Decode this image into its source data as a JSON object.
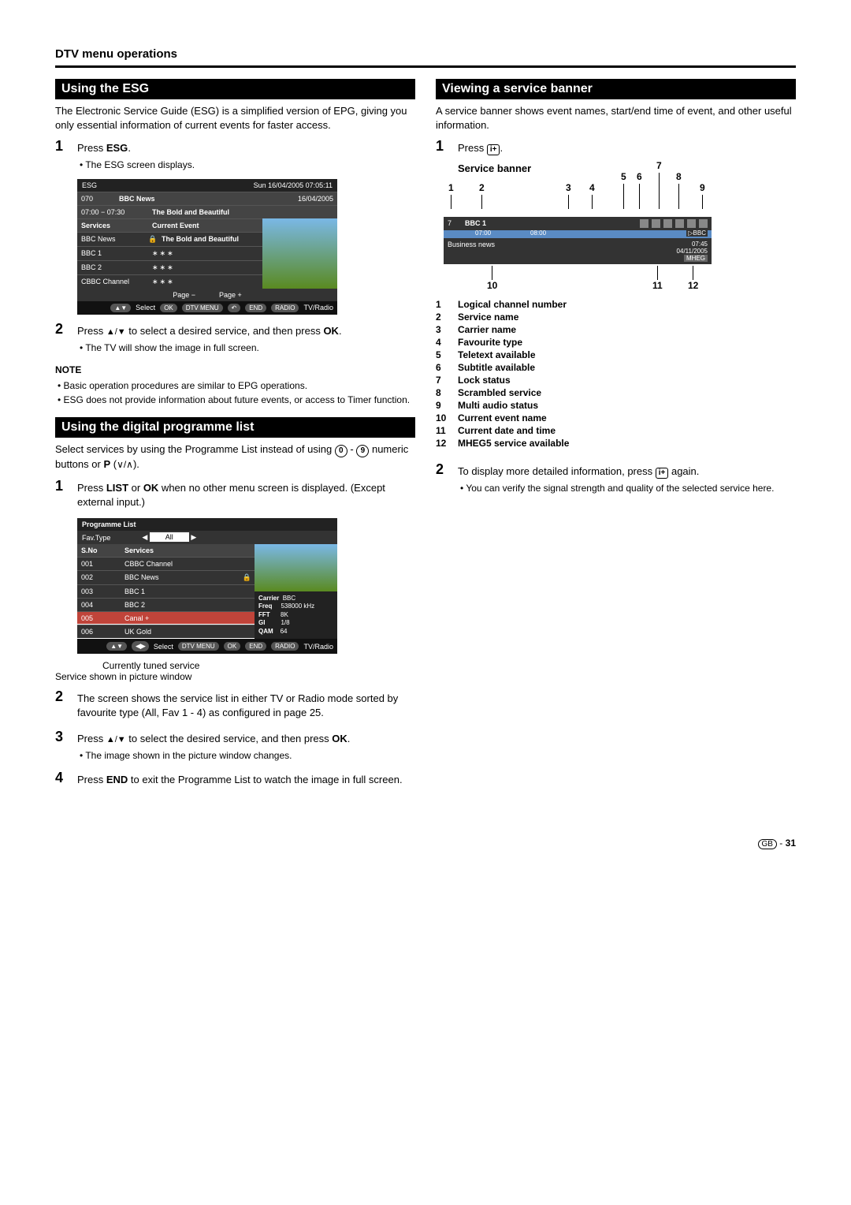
{
  "page_heading": "DTV menu operations",
  "left": {
    "sec1_title": "Using the ESG",
    "sec1_intro": "The Electronic Service Guide (ESG) is a simplified version of EPG, giving you only essential information of current events for faster access.",
    "s1_step1_a": "Press ",
    "s1_step1_b": "ESG",
    "s1_step1_c": ".",
    "s1_step1_bullet": "• The ESG screen displays.",
    "esg": {
      "title": "ESG",
      "datetime": "Sun  16/04/2005  07:05:11",
      "ch_num": "070",
      "ch_name": "BBC News",
      "ch_date": "16/04/2005",
      "time_range": "07:00 − 07:30",
      "cur_prog": "The Bold and Beautiful",
      "col_services": "Services",
      "col_event": "Current Event",
      "rows": [
        {
          "svc": "BBC News",
          "ev": "The Bold and Beautiful",
          "locked": true
        },
        {
          "svc": "BBC 1",
          "ev": "∗∗∗"
        },
        {
          "svc": "BBC 2",
          "ev": "∗∗∗"
        },
        {
          "svc": "CBBC Channel",
          "ev": "∗∗∗"
        }
      ],
      "page_minus": "Page −",
      "page_plus": "Page +",
      "foot_select": "Select",
      "foot_ok": "OK",
      "foot_dtv": "DTV MENU",
      "foot_end": "END",
      "foot_radio": "RADIO",
      "foot_tvr": "TV/Radio"
    },
    "s1_step2_a": "Press ",
    "s1_step2_b": " to select a desired service, and then press ",
    "s1_step2_c": "OK",
    "s1_step2_d": ".",
    "s1_step2_bullet": "• The TV will show the image in full screen.",
    "note_label": "NOTE",
    "note1": "• Basic operation procedures are similar to EPG operations.",
    "note2": "• ESG does not provide information about future events, or access to Timer function.",
    "sec2_title": "Using the digital programme list",
    "sec2_intro_a": "Select services by using the Programme List instead of using ",
    "sec2_intro_b": " - ",
    "sec2_intro_c": " numeric buttons or ",
    "sec2_intro_d": "P",
    "sec2_intro_e": " (",
    "sec2_intro_f": ").",
    "s2_step1_a": "Press ",
    "s2_step1_b": "LIST",
    "s2_step1_c": " or ",
    "s2_step1_d": "OK",
    "s2_step1_e": " when no other menu screen is displayed. (Except external input.)",
    "plist": {
      "title": "Programme List",
      "fav_label": "Fav.Type",
      "fav_val": "All",
      "col_sno": "S.No",
      "col_svc": "Services",
      "rows": [
        {
          "n": "001",
          "s": "CBBC Channel"
        },
        {
          "n": "002",
          "s": "BBC News",
          "locked": true
        },
        {
          "n": "003",
          "s": "BBC 1"
        },
        {
          "n": "004",
          "s": "BBC 2"
        },
        {
          "n": "005",
          "s": "Canal +",
          "hl": true
        },
        {
          "n": "006",
          "s": "UK Gold",
          "sel": true
        }
      ],
      "info": {
        "Carrier": "BBC",
        "Freq": "538000 kHz",
        "FFT": "8K",
        "GI": "1/8",
        "QAM": "64"
      },
      "foot_select": "Select",
      "foot_ok": "OK",
      "foot_dtv": "DTV MENU",
      "foot_end": "END",
      "foot_radio": "RADIO",
      "foot_tvr": "TV/Radio"
    },
    "cap_tuned": "Currently tuned service",
    "cap_shown": "Service shown in picture window",
    "s2_step2": "The screen shows the service list in either TV or Radio mode sorted by favourite type (All, Fav 1 - 4) as configured in page 25.",
    "s2_step3_a": "Press ",
    "s2_step3_b": " to select the desired service, and then press ",
    "s2_step3_c": "OK",
    "s2_step3_d": ".",
    "s2_step3_bullet": "• The image shown in the picture window changes.",
    "s2_step4_a": "Press ",
    "s2_step4_b": "END",
    "s2_step4_c": " to exit the Programme List to watch the image in full screen."
  },
  "right": {
    "sec_title": "Viewing a service banner",
    "intro": "A service banner shows event names, start/end time of event, and other useful information.",
    "step1_a": "Press ",
    "step1_b": ".",
    "sb_label": "Service banner",
    "callouts": {
      "c1": "1",
      "c2": "2",
      "c3": "3",
      "c4": "4",
      "c5": "5",
      "c6": "6",
      "c7": "7",
      "c8": "8",
      "c9": "9",
      "c10": "10",
      "c11": "11",
      "c12": "12"
    },
    "sb": {
      "lcn": "7",
      "svc": "BBC 1",
      "carrier": "BBC",
      "t1": "07:00",
      "t2": "08:00",
      "evt": "Business news",
      "dt1": "07:45",
      "dt2": "04/11/2005",
      "mheg": "MHEG"
    },
    "legend": [
      {
        "k": "1",
        "v": "Logical channel number"
      },
      {
        "k": "2",
        "v": "Service name"
      },
      {
        "k": "3",
        "v": "Carrier name"
      },
      {
        "k": "4",
        "v": "Favourite type"
      },
      {
        "k": "5",
        "v": "Teletext available"
      },
      {
        "k": "6",
        "v": "Subtitle available"
      },
      {
        "k": "7",
        "v": "Lock status"
      },
      {
        "k": "8",
        "v": "Scrambled service"
      },
      {
        "k": "9",
        "v": "Multi audio status"
      },
      {
        "k": "10",
        "v": "Current event name"
      },
      {
        "k": "11",
        "v": "Current date and time"
      },
      {
        "k": "12",
        "v": "MHEG5 service available"
      }
    ],
    "step2_a": "To display more detailed information, press ",
    "step2_b": " again.",
    "step2_bullet": "• You can verify the signal strength and quality of the selected service here."
  },
  "page_num": "31",
  "zero": "0",
  "nine": "9",
  "info_glyph": "i+",
  "gb": "GB"
}
